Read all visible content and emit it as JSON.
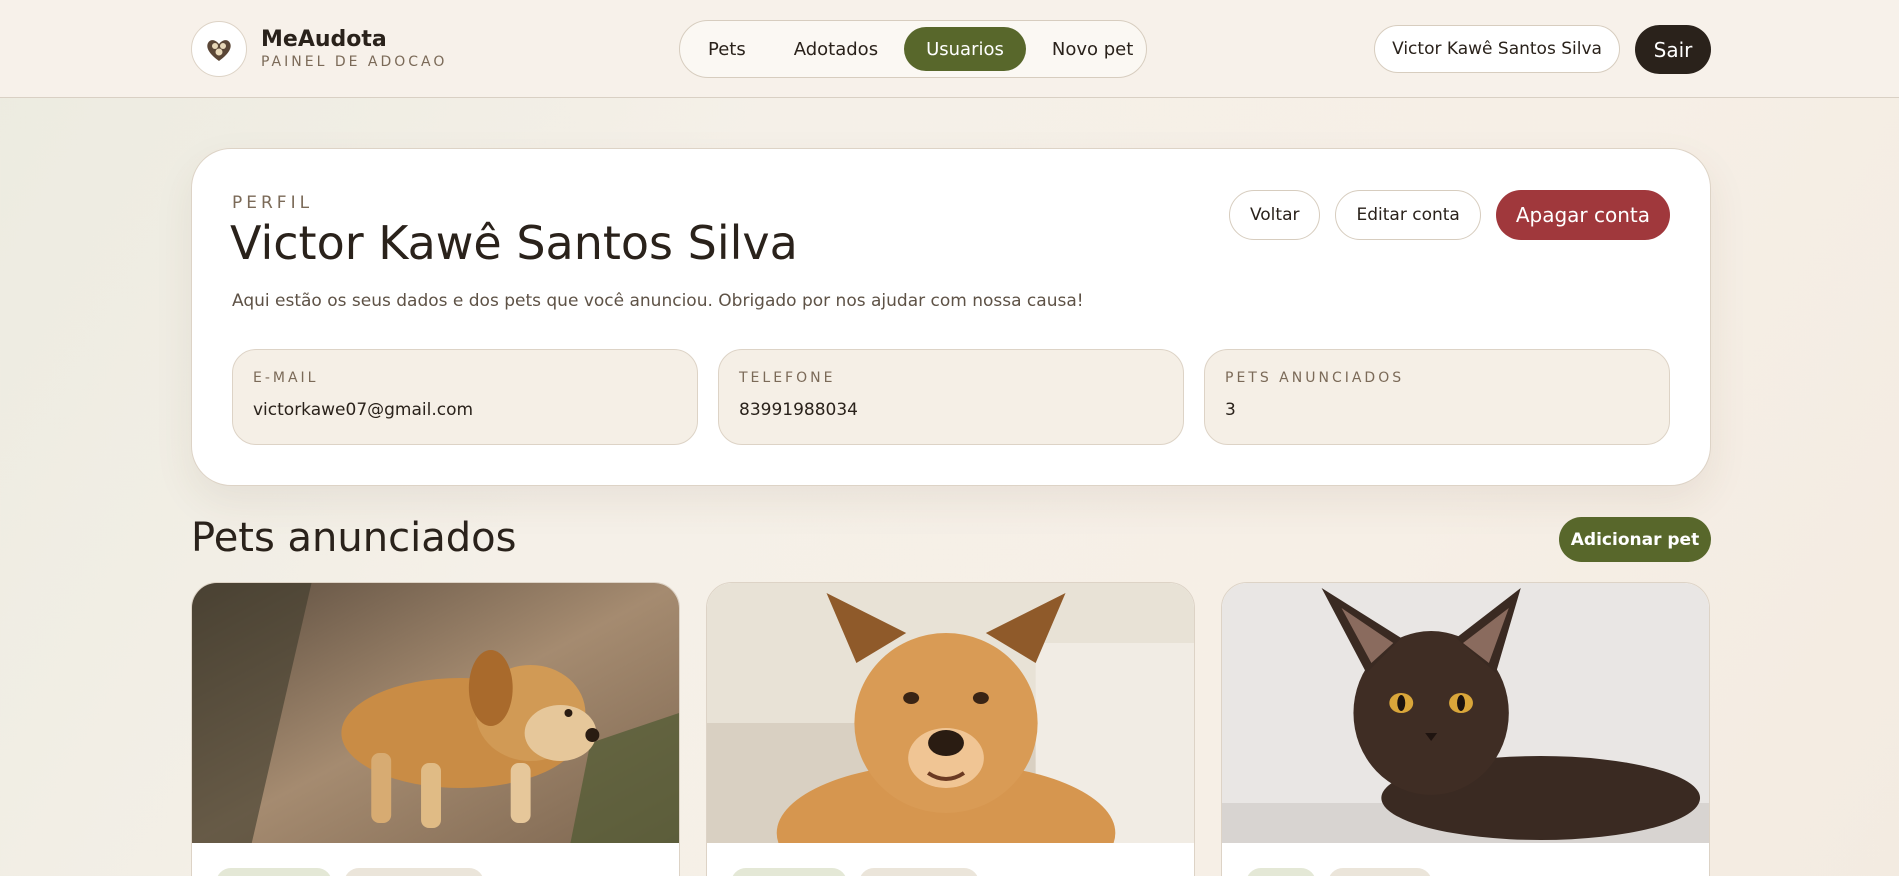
{
  "app": {
    "name": "MeAudota",
    "subtitle": "PAINEL DE ADOCAO"
  },
  "nav": {
    "items": [
      {
        "label": "Pets",
        "active": false
      },
      {
        "label": "Adotados",
        "active": false
      },
      {
        "label": "Usuarios",
        "active": true
      },
      {
        "label": "Novo pet",
        "active": false
      }
    ]
  },
  "header": {
    "user_name": "Victor Kawê Santos Silva",
    "logout_label": "Sair"
  },
  "profile": {
    "eyebrow": "PERFIL",
    "name": "Victor Kawê Santos Silva",
    "description": "Aqui estão os seus dados e dos pets que você anunciou. Obrigado por nos ajudar com nossa causa!",
    "actions": {
      "back_label": "Voltar",
      "edit_label": "Editar conta",
      "delete_label": "Apagar conta"
    },
    "fields": [
      {
        "label": "E-MAIL",
        "value": "victorkawe07@gmail.com"
      },
      {
        "label": "TELEFONE",
        "value": "83991988034"
      },
      {
        "label": "PETS ANUNCIADOS",
        "value": "3"
      }
    ]
  },
  "pets_section": {
    "title": "Pets anunciados",
    "add_label": "Adicionar pet"
  },
  "colors": {
    "accent_green": "#58672b",
    "danger_red": "#a0383c",
    "dark": "#2a221b"
  }
}
